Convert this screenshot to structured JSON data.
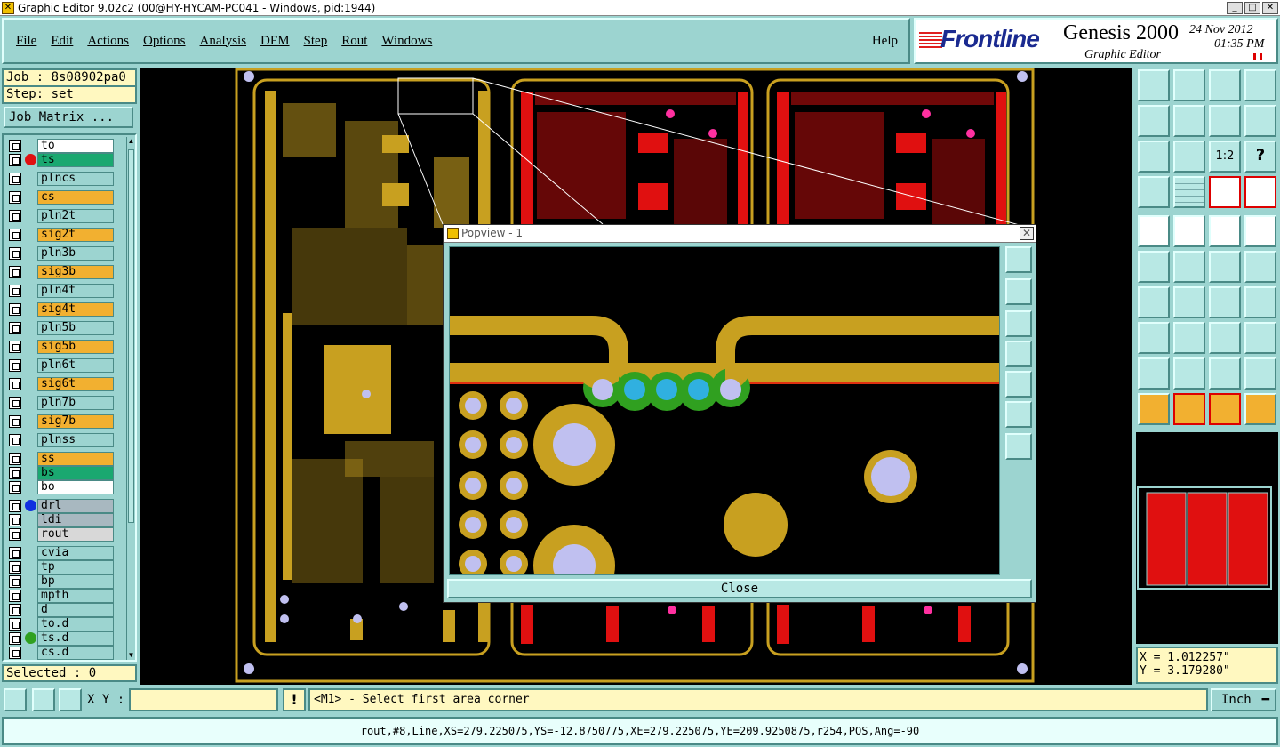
{
  "window": {
    "title": "Graphic Editor 9.02c2 (00@HY-HYCAM-PC041 - Windows, pid:1944)"
  },
  "menu": {
    "items": [
      "File",
      "Edit",
      "Actions",
      "Options",
      "Analysis",
      "DFM",
      "Step",
      "Rout",
      "Windows"
    ],
    "help": "Help"
  },
  "logo": {
    "brand": "Frontline",
    "product": "Genesis 2000",
    "subtitle": "Graphic Editor",
    "date": "24 Nov 2012",
    "time": "01:35 PM"
  },
  "job": {
    "label": "Job : 8s08902pa0",
    "step": "Step: set",
    "matrix_button": "Job Matrix ..."
  },
  "layers": [
    {
      "name": "to",
      "color": "#ffffff",
      "dot": ""
    },
    {
      "name": "ts",
      "color": "#1aa870",
      "dot": "#e01010"
    },
    {
      "name": "plncs",
      "color": "#9cd4d0",
      "dot": ""
    },
    {
      "name": "cs",
      "color": "#f2b030",
      "dot": ""
    },
    {
      "name": "pln2t",
      "color": "#9cd4d0",
      "dot": ""
    },
    {
      "name": "sig2t",
      "color": "#f2b030",
      "dot": ""
    },
    {
      "name": "pln3b",
      "color": "#9cd4d0",
      "dot": ""
    },
    {
      "name": "sig3b",
      "color": "#f2b030",
      "dot": ""
    },
    {
      "name": "pln4t",
      "color": "#9cd4d0",
      "dot": ""
    },
    {
      "name": "sig4t",
      "color": "#f2b030",
      "dot": ""
    },
    {
      "name": "pln5b",
      "color": "#9cd4d0",
      "dot": ""
    },
    {
      "name": "sig5b",
      "color": "#f2b030",
      "dot": ""
    },
    {
      "name": "pln6t",
      "color": "#9cd4d0",
      "dot": ""
    },
    {
      "name": "sig6t",
      "color": "#f2b030",
      "dot": ""
    },
    {
      "name": "pln7b",
      "color": "#9cd4d0",
      "dot": ""
    },
    {
      "name": "sig7b",
      "color": "#f2b030",
      "dot": ""
    },
    {
      "name": "plnss",
      "color": "#9cd4d0",
      "dot": ""
    },
    {
      "name": "ss",
      "color": "#f2b030",
      "dot": ""
    },
    {
      "name": "bs",
      "color": "#1aa870",
      "dot": ""
    },
    {
      "name": "bo",
      "color": "#ffffff",
      "dot": ""
    },
    {
      "name": "drl",
      "color": "#a8b8c0",
      "dot": "#1030e0"
    },
    {
      "name": "ldi",
      "color": "#a8b8c0",
      "dot": ""
    },
    {
      "name": "rout",
      "color": "#d8d8d8",
      "dot": ""
    },
    {
      "name": "cvia",
      "color": "#9cd4d0",
      "dot": ""
    },
    {
      "name": "tp",
      "color": "#9cd4d0",
      "dot": ""
    },
    {
      "name": "bp",
      "color": "#9cd4d0",
      "dot": ""
    },
    {
      "name": "mpth",
      "color": "#9cd4d0",
      "dot": ""
    },
    {
      "name": "d",
      "color": "#9cd4d0",
      "dot": ""
    },
    {
      "name": "to.d",
      "color": "#9cd4d0",
      "dot": ""
    },
    {
      "name": "ts.d",
      "color": "#9cd4d0",
      "dot": "#30a020"
    },
    {
      "name": "cs.d",
      "color": "#9cd4d0",
      "dot": ""
    }
  ],
  "selected": "Selected : 0",
  "popview": {
    "title": "Popview - 1",
    "close_label": "Close"
  },
  "coords": {
    "x": "X = 1.012257\"",
    "y": "Y = 3.179280\""
  },
  "bottom": {
    "xy_label": "X Y :",
    "xy_value": "",
    "excl": "!",
    "prompt": "<M1> - Select first area corner",
    "units": "Inch"
  },
  "status": "rout,#8,Line,XS=279.225075,YS=-12.8750775,XE=279.225075,YE=209.9250875,r254,POS,Ang=-90",
  "colors": {
    "copper": "#c8a020",
    "top": "#e01010",
    "drill": "#c0c0f0",
    "mask": "#30a020",
    "via": "#30b0e0"
  }
}
